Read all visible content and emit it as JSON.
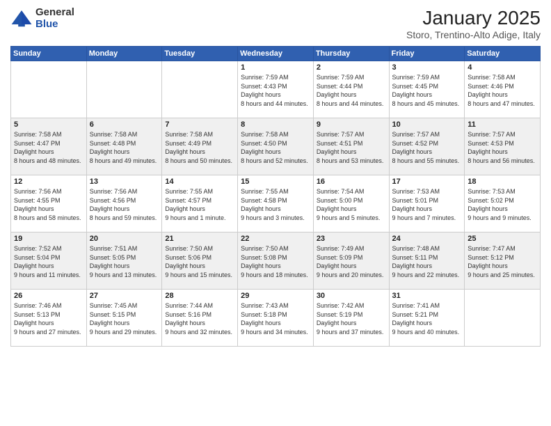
{
  "logo": {
    "general": "General",
    "blue": "Blue"
  },
  "title": "January 2025",
  "location": "Storo, Trentino-Alto Adige, Italy",
  "days_of_week": [
    "Sunday",
    "Monday",
    "Tuesday",
    "Wednesday",
    "Thursday",
    "Friday",
    "Saturday"
  ],
  "weeks": [
    [
      {
        "num": "",
        "sunrise": "",
        "sunset": "",
        "daylight": ""
      },
      {
        "num": "",
        "sunrise": "",
        "sunset": "",
        "daylight": ""
      },
      {
        "num": "",
        "sunrise": "",
        "sunset": "",
        "daylight": ""
      },
      {
        "num": "1",
        "sunrise": "7:59 AM",
        "sunset": "4:43 PM",
        "daylight": "8 hours and 44 minutes."
      },
      {
        "num": "2",
        "sunrise": "7:59 AM",
        "sunset": "4:44 PM",
        "daylight": "8 hours and 44 minutes."
      },
      {
        "num": "3",
        "sunrise": "7:59 AM",
        "sunset": "4:45 PM",
        "daylight": "8 hours and 45 minutes."
      },
      {
        "num": "4",
        "sunrise": "7:58 AM",
        "sunset": "4:46 PM",
        "daylight": "8 hours and 47 minutes."
      }
    ],
    [
      {
        "num": "5",
        "sunrise": "7:58 AM",
        "sunset": "4:47 PM",
        "daylight": "8 hours and 48 minutes."
      },
      {
        "num": "6",
        "sunrise": "7:58 AM",
        "sunset": "4:48 PM",
        "daylight": "8 hours and 49 minutes."
      },
      {
        "num": "7",
        "sunrise": "7:58 AM",
        "sunset": "4:49 PM",
        "daylight": "8 hours and 50 minutes."
      },
      {
        "num": "8",
        "sunrise": "7:58 AM",
        "sunset": "4:50 PM",
        "daylight": "8 hours and 52 minutes."
      },
      {
        "num": "9",
        "sunrise": "7:57 AM",
        "sunset": "4:51 PM",
        "daylight": "8 hours and 53 minutes."
      },
      {
        "num": "10",
        "sunrise": "7:57 AM",
        "sunset": "4:52 PM",
        "daylight": "8 hours and 55 minutes."
      },
      {
        "num": "11",
        "sunrise": "7:57 AM",
        "sunset": "4:53 PM",
        "daylight": "8 hours and 56 minutes."
      }
    ],
    [
      {
        "num": "12",
        "sunrise": "7:56 AM",
        "sunset": "4:55 PM",
        "daylight": "8 hours and 58 minutes."
      },
      {
        "num": "13",
        "sunrise": "7:56 AM",
        "sunset": "4:56 PM",
        "daylight": "8 hours and 59 minutes."
      },
      {
        "num": "14",
        "sunrise": "7:55 AM",
        "sunset": "4:57 PM",
        "daylight": "9 hours and 1 minute."
      },
      {
        "num": "15",
        "sunrise": "7:55 AM",
        "sunset": "4:58 PM",
        "daylight": "9 hours and 3 minutes."
      },
      {
        "num": "16",
        "sunrise": "7:54 AM",
        "sunset": "5:00 PM",
        "daylight": "9 hours and 5 minutes."
      },
      {
        "num": "17",
        "sunrise": "7:53 AM",
        "sunset": "5:01 PM",
        "daylight": "9 hours and 7 minutes."
      },
      {
        "num": "18",
        "sunrise": "7:53 AM",
        "sunset": "5:02 PM",
        "daylight": "9 hours and 9 minutes."
      }
    ],
    [
      {
        "num": "19",
        "sunrise": "7:52 AM",
        "sunset": "5:04 PM",
        "daylight": "9 hours and 11 minutes."
      },
      {
        "num": "20",
        "sunrise": "7:51 AM",
        "sunset": "5:05 PM",
        "daylight": "9 hours and 13 minutes."
      },
      {
        "num": "21",
        "sunrise": "7:50 AM",
        "sunset": "5:06 PM",
        "daylight": "9 hours and 15 minutes."
      },
      {
        "num": "22",
        "sunrise": "7:50 AM",
        "sunset": "5:08 PM",
        "daylight": "9 hours and 18 minutes."
      },
      {
        "num": "23",
        "sunrise": "7:49 AM",
        "sunset": "5:09 PM",
        "daylight": "9 hours and 20 minutes."
      },
      {
        "num": "24",
        "sunrise": "7:48 AM",
        "sunset": "5:11 PM",
        "daylight": "9 hours and 22 minutes."
      },
      {
        "num": "25",
        "sunrise": "7:47 AM",
        "sunset": "5:12 PM",
        "daylight": "9 hours and 25 minutes."
      }
    ],
    [
      {
        "num": "26",
        "sunrise": "7:46 AM",
        "sunset": "5:13 PM",
        "daylight": "9 hours and 27 minutes."
      },
      {
        "num": "27",
        "sunrise": "7:45 AM",
        "sunset": "5:15 PM",
        "daylight": "9 hours and 29 minutes."
      },
      {
        "num": "28",
        "sunrise": "7:44 AM",
        "sunset": "5:16 PM",
        "daylight": "9 hours and 32 minutes."
      },
      {
        "num": "29",
        "sunrise": "7:43 AM",
        "sunset": "5:18 PM",
        "daylight": "9 hours and 34 minutes."
      },
      {
        "num": "30",
        "sunrise": "7:42 AM",
        "sunset": "5:19 PM",
        "daylight": "9 hours and 37 minutes."
      },
      {
        "num": "31",
        "sunrise": "7:41 AM",
        "sunset": "5:21 PM",
        "daylight": "9 hours and 40 minutes."
      },
      {
        "num": "",
        "sunrise": "",
        "sunset": "",
        "daylight": ""
      }
    ]
  ]
}
